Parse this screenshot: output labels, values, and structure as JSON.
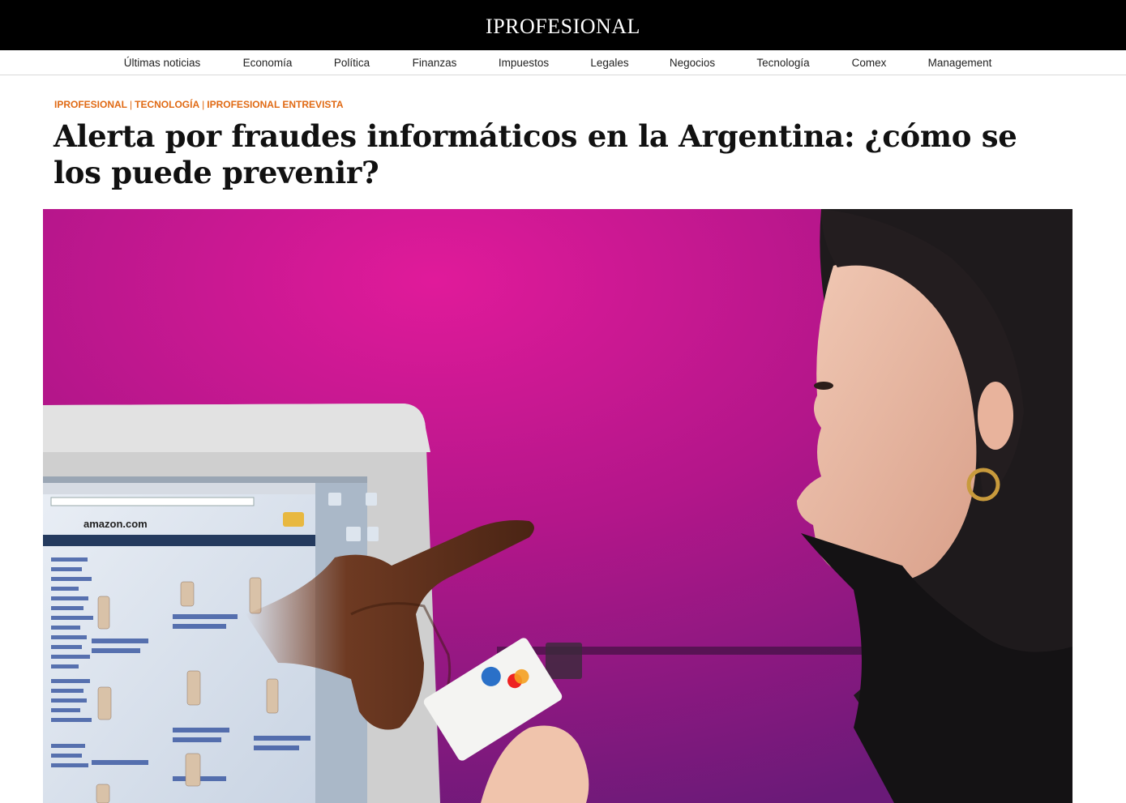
{
  "site": {
    "logo": "IPROFESIONAL"
  },
  "nav": {
    "items": [
      {
        "label": "Últimas noticias"
      },
      {
        "label": "Economía"
      },
      {
        "label": "Política"
      },
      {
        "label": "Finanzas"
      },
      {
        "label": "Impuestos"
      },
      {
        "label": "Legales"
      },
      {
        "label": "Negocios"
      },
      {
        "label": "Tecnología"
      },
      {
        "label": "Comex"
      },
      {
        "label": "Management"
      }
    ]
  },
  "article": {
    "breadcrumb": [
      "IPROFESIONAL",
      "TECNOLOGÍA",
      "IPROFESIONAL ENTREVISTA"
    ],
    "breadcrumb_separator": "|",
    "title": "Alerta por fraudes informáticos en la Argentina: ¿cómo se los puede prevenir?",
    "hero_image": {
      "screen_text": "amazon.com"
    }
  },
  "colors": {
    "topbar": "#000000",
    "accent": "#e06a14",
    "hero_magenta": "#c0168a"
  }
}
